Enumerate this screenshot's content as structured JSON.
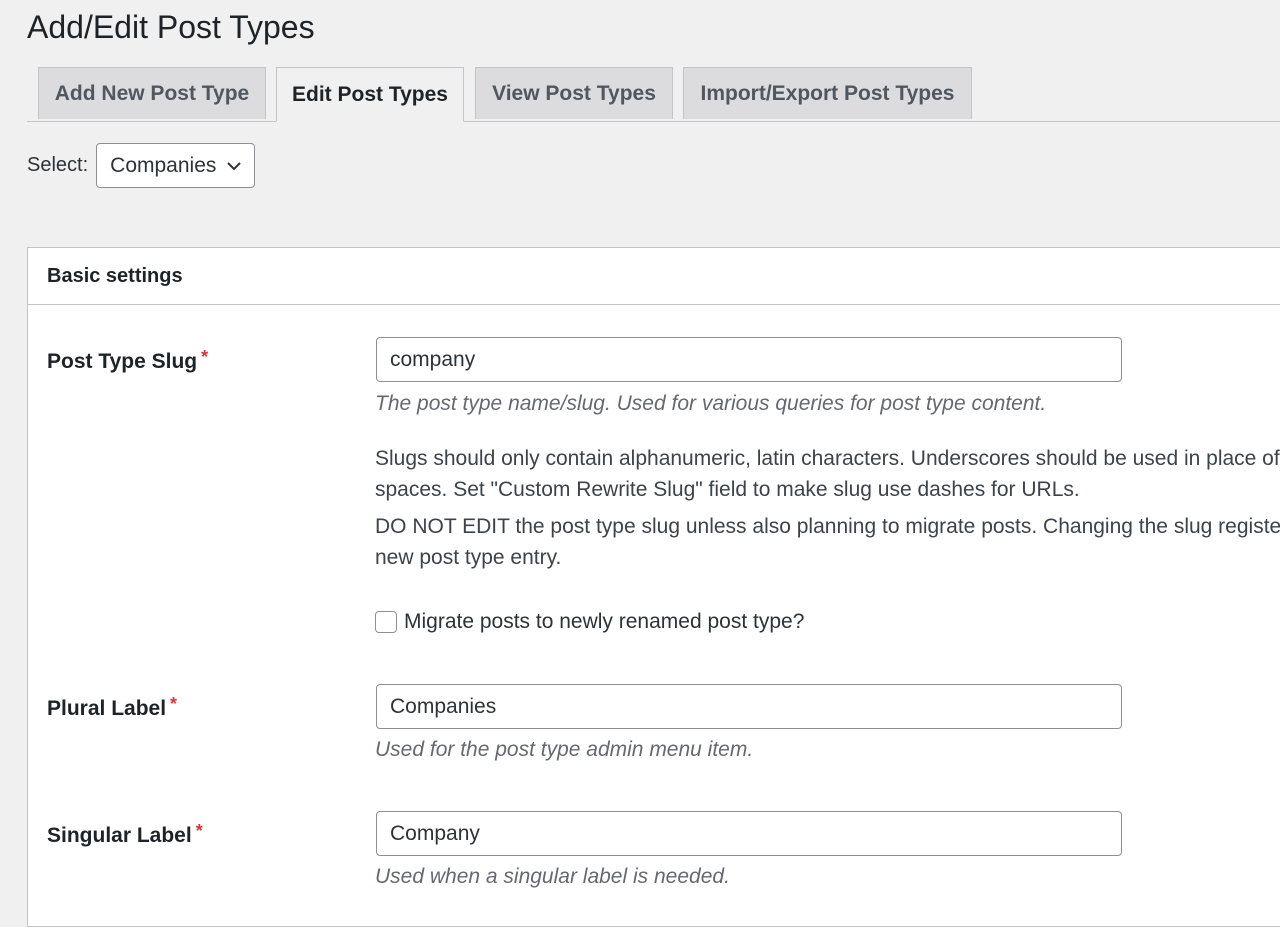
{
  "page": {
    "title": "Add/Edit Post Types"
  },
  "tabs": [
    {
      "label": "Add New Post Type",
      "active": false
    },
    {
      "label": "Edit Post Types",
      "active": true
    },
    {
      "label": "View Post Types",
      "active": false
    },
    {
      "label": "Import/Export Post Types",
      "active": false
    }
  ],
  "selector": {
    "label": "Select:",
    "value": "Companies",
    "icon": "chevron-down-icon"
  },
  "panel": {
    "title": "Basic settings",
    "required_mark": "*",
    "slug": {
      "label": "Post Type Slug",
      "value": "company",
      "description": "The post type name/slug. Used for various queries for post type content.",
      "note1_line1": "Slugs should only contain alphanumeric, latin characters. Underscores should be used in place of",
      "note1_line2": "spaces. Set \"Custom Rewrite Slug\" field to make slug use dashes for URLs.",
      "note2_line1": "DO NOT EDIT the post type slug unless also planning to migrate posts. Changing the slug registers a",
      "note2_line2": "new post type entry.",
      "migrate_label": "Migrate posts to newly renamed post type?",
      "migrate_checked": false
    },
    "plural": {
      "label": "Plural Label",
      "value": "Companies",
      "description": "Used for the post type admin menu item."
    },
    "singular": {
      "label": "Singular Label",
      "value": "Company",
      "description": "Used when a singular label is needed."
    }
  },
  "colors": {
    "required": "#d63638",
    "background": "#f0f0f1",
    "border": "#c3c4c7"
  }
}
